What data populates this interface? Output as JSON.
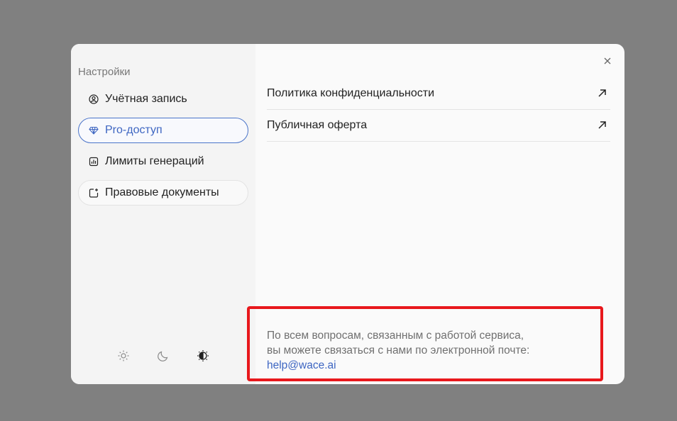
{
  "sidebar": {
    "title": "Настройки",
    "items": [
      {
        "label": "Учётная запись",
        "icon": "user-circle-icon"
      },
      {
        "label": "Pro-доступ",
        "icon": "diamond-icon"
      },
      {
        "label": "Лимиты генераций",
        "icon": "bar-chart-icon"
      },
      {
        "label": "Правовые документы",
        "icon": "document-add-icon"
      }
    ],
    "themes": [
      "sun-icon",
      "moon-icon",
      "auto-theme-icon"
    ]
  },
  "main": {
    "documents": [
      {
        "label": "Политика конфиденциальности",
        "icon": "external-arrow-icon"
      },
      {
        "label": "Публичная оферта",
        "icon": "external-arrow-icon"
      }
    ],
    "contact": {
      "line1": "По всем вопросам, связанным с работой сервиса,",
      "line2": "вы можете связаться с нами по электронной почте:",
      "email": "help@wace.ai"
    }
  },
  "colors": {
    "accent": "#3e66c2",
    "highlight": "#e8181c",
    "overlay": "#808080"
  }
}
